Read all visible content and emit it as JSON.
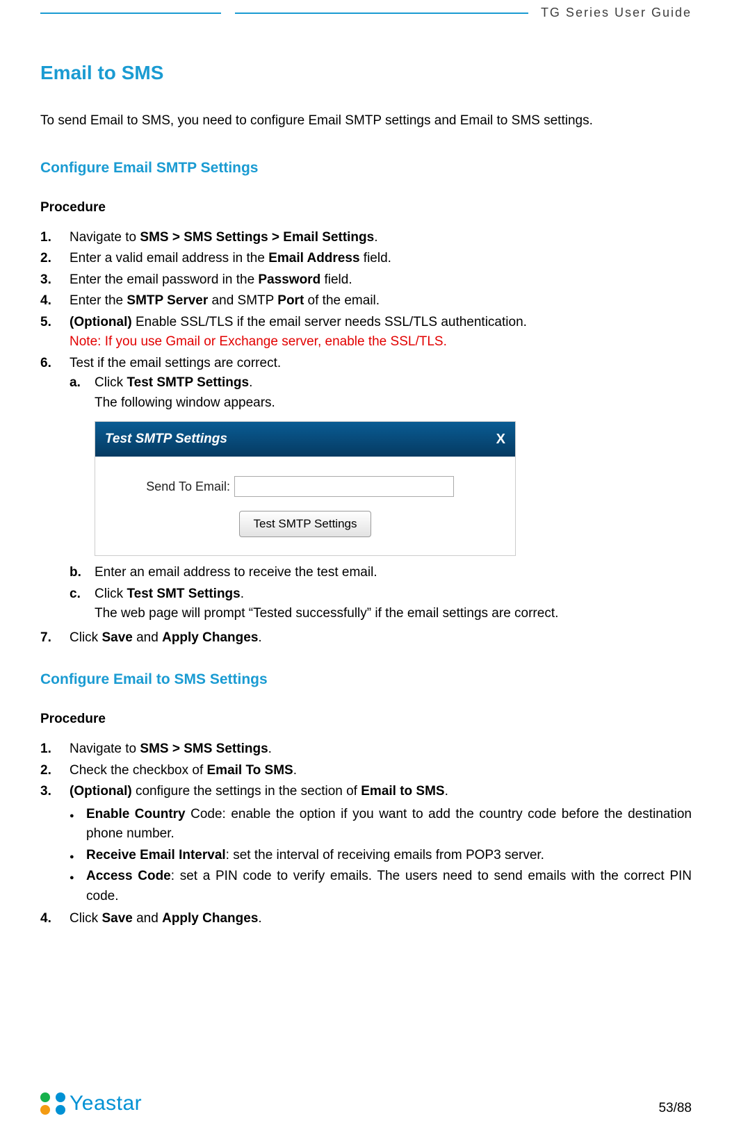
{
  "header": {
    "doc_title": "TG  Series  User  Guide"
  },
  "h1": "Email to SMS",
  "intro": "To send Email to SMS, you need to configure Email SMTP settings and Email to SMS settings.",
  "section1": {
    "title": "Configure Email SMTP Settings",
    "procedure_label": "Procedure",
    "steps": {
      "s1_pre": "Navigate to ",
      "s1_bold": "SMS > SMS Settings > Email Settings",
      "s1_post": ".",
      "s2_pre": "Enter a valid email address in the ",
      "s2_bold": "Email Address",
      "s2_post": " field.",
      "s3_pre": "Enter the email password in the ",
      "s3_bold": "Password",
      "s3_post": " field.",
      "s4_pre": "Enter the ",
      "s4_b1": "SMTP Server",
      "s4_mid": " and SMTP ",
      "s4_b2": "Port",
      "s4_post": " of the email.",
      "s5_b": "(Optional) ",
      "s5_post": "Enable SSL/TLS if the email server needs SSL/TLS authentication.",
      "s5_note": "Note: If you use Gmail or Exchange server, enable the SSL/TLS.",
      "s6": "Test if the email settings are correct.",
      "s6a_pre": "Click ",
      "s6a_b": "Test SMTP Settings",
      "s6a_post": ".",
      "s6a_sub": "The following window appears.",
      "s6b": "Enter an email address to receive the test email.",
      "s6c_pre": "Click ",
      "s6c_b": "Test SMT Settings",
      "s6c_post": ".",
      "s6c_sub": "The web page will prompt “Tested successfully” if the email settings are correct.",
      "s7_pre": "Click ",
      "s7_b1": "Save",
      "s7_mid": " and ",
      "s7_b2": "Apply Changes",
      "s7_post": "."
    },
    "dialog": {
      "title": "Test SMTP Settings",
      "close": "X",
      "label": "Send To Email:",
      "input_value": "",
      "button": "Test SMTP Settings"
    }
  },
  "section2": {
    "title": "Configure Email to SMS Settings",
    "procedure_label": "Procedure",
    "steps": {
      "s1_pre": "Navigate to ",
      "s1_bold": "SMS > SMS Settings",
      "s1_post": ".",
      "s2_pre": "Check the checkbox of ",
      "s2_bold": "Email To SMS",
      "s2_post": ".",
      "s3_b": "(Optional) ",
      "s3_mid": "configure the settings in the section of ",
      "s3_b2": "Email to SMS",
      "s3_post": ".",
      "b1_b": "Enable Country",
      "b1_post": " Code: enable the option if you want to add the country code before the destination phone number.",
      "b2_b": "Receive Email Interval",
      "b2_post": ": set the interval of receiving emails from POP3 server.",
      "b3_b": "Access Code",
      "b3_post": ": set a PIN code to verify emails. The users need to send emails with the correct PIN code.",
      "s4_pre": "Click ",
      "s4_b1": "Save",
      "s4_mid": " and ",
      "s4_b2": "Apply Changes",
      "s4_post": "."
    }
  },
  "footer": {
    "logo_text": "Yeastar",
    "page_num": "53/88"
  }
}
